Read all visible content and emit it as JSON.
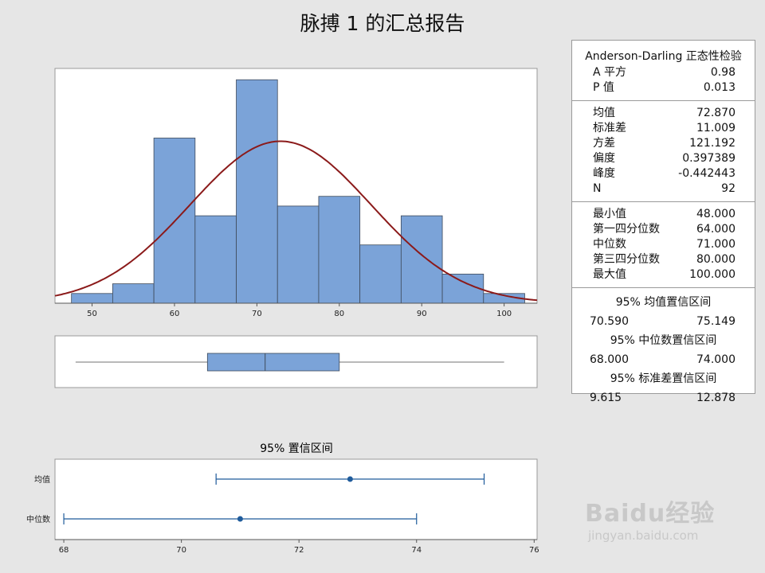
{
  "title": "脉搏 1 的汇总报告",
  "colors": {
    "bar": "#7ba3d8",
    "bar_edge": "#3e4a5a",
    "curve": "#8b1a1a",
    "ci": "#1f5b9b"
  },
  "chart_data": [
    {
      "type": "bar",
      "name": "histogram",
      "bin_width": 5,
      "bins": [
        {
          "x0": 47.5,
          "x1": 52.5,
          "count": 1
        },
        {
          "x0": 52.5,
          "x1": 57.5,
          "count": 2
        },
        {
          "x0": 57.5,
          "x1": 62.5,
          "count": 17
        },
        {
          "x0": 62.5,
          "x1": 67.5,
          "count": 9
        },
        {
          "x0": 67.5,
          "x1": 72.5,
          "count": 23
        },
        {
          "x0": 72.5,
          "x1": 77.5,
          "count": 10
        },
        {
          "x0": 77.5,
          "x1": 82.5,
          "count": 11
        },
        {
          "x0": 82.5,
          "x1": 87.5,
          "count": 6
        },
        {
          "x0": 87.5,
          "x1": 92.5,
          "count": 9
        },
        {
          "x0": 92.5,
          "x1": 97.5,
          "count": 3
        },
        {
          "x0": 97.5,
          "x1": 102.5,
          "count": 1
        }
      ],
      "normal_curve": {
        "mean": 72.87,
        "sd": 11.009,
        "n": 92
      },
      "xticks": [
        50,
        60,
        70,
        80,
        90,
        100
      ],
      "xlim": [
        45.5,
        104
      ],
      "ylim": [
        0,
        24
      ]
    },
    {
      "type": "boxplot",
      "name": "boxplot",
      "min": 48.0,
      "q1": 64.0,
      "median": 71.0,
      "q3": 80.0,
      "max": 100.0,
      "xlim": [
        45.5,
        104
      ]
    },
    {
      "type": "interval",
      "name": "confidence-intervals",
      "title": "95% 置信区间",
      "intervals": [
        {
          "label": "均值",
          "lower": 70.59,
          "estimate": 72.87,
          "upper": 75.149
        },
        {
          "label": "中位数",
          "lower": 68.0,
          "estimate": 71.0,
          "upper": 74.0
        }
      ],
      "xticks": [
        68,
        70,
        72,
        74,
        76
      ],
      "xlim": [
        67.85,
        76.05
      ]
    }
  ],
  "stats": {
    "ad_title": "Anderson-Darling 正态性检验",
    "ad": [
      {
        "label": "A 平方",
        "value": "0.98"
      },
      {
        "label": "P 值",
        "value": "0.013"
      }
    ],
    "moments": [
      {
        "label": "均值",
        "value": "72.870"
      },
      {
        "label": "标准差",
        "value": "11.009"
      },
      {
        "label": "方差",
        "value": "121.192"
      },
      {
        "label": "偏度",
        "value": "0.397389"
      },
      {
        "label": "峰度",
        "value": "-0.442443"
      },
      {
        "label": "N",
        "value": "92"
      }
    ],
    "quantiles": [
      {
        "label": "最小值",
        "value": "48.000"
      },
      {
        "label": "第一四分位数",
        "value": "64.000"
      },
      {
        "label": "中位数",
        "value": "71.000"
      },
      {
        "label": "第三四分位数",
        "value": "80.000"
      },
      {
        "label": "最大值",
        "value": "100.000"
      }
    ],
    "ci_mean": {
      "title": "95% 均值置信区间",
      "lower": "70.590",
      "upper": "75.149"
    },
    "ci_median": {
      "title": "95% 中位数置信区间",
      "lower": "68.000",
      "upper": "74.000"
    },
    "ci_sd": {
      "title": "95% 标准差置信区间",
      "lower": "9.615",
      "upper": "12.878"
    }
  },
  "watermark": {
    "logo": "Baidu经验",
    "url": "jingyan.baidu.com"
  }
}
